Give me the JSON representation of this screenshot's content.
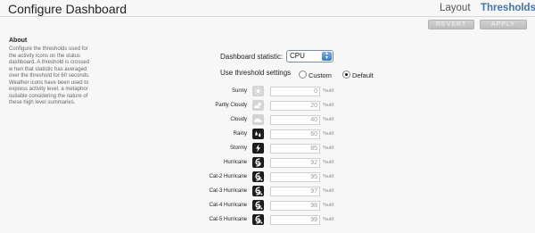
{
  "header": {
    "title": "Configure Dashboard",
    "tabs": {
      "layout": "Layout",
      "thresholds": "Thresholds"
    }
  },
  "toolbar": {
    "revert_label": "REVERT",
    "apply_label": "APPLY"
  },
  "about": {
    "title": "About",
    "lines": [
      "Configure the thresholds used for",
      "the activity icons on the status",
      "dashboard. A threshold is crossed",
      "w hen that statistic has averaged",
      "over the threshold for 60 seconds.",
      "Weather icons have been used to",
      "express activity level, a metaphor",
      "suitable considering the nature of",
      "these high level summaries."
    ]
  },
  "form": {
    "statistic_label": "Dashboard statistic:",
    "statistic_value": "CPU",
    "use_threshold_label": "Use threshold settings",
    "option_custom": "Custom",
    "option_default": "Default",
    "selected_option": "Default",
    "unit": "%util"
  },
  "thresholds": [
    {
      "label": "Sunny",
      "value": "0",
      "icon": "sun-icon"
    },
    {
      "label": "Partly Cloudy",
      "value": "20",
      "icon": "partly-cloudy-icon"
    },
    {
      "label": "Cloudy",
      "value": "40",
      "icon": "cloud-icon"
    },
    {
      "label": "Rainy",
      "value": "60",
      "icon": "rain-icon"
    },
    {
      "label": "Stormy",
      "value": "85",
      "icon": "lightning-icon"
    },
    {
      "label": "Hurricane",
      "value": "92",
      "icon": "hurricane-icon"
    },
    {
      "label": "Cat-2 Hurricane",
      "value": "95",
      "icon": "hurricane-cat2-icon"
    },
    {
      "label": "Cat-3 Hurricane",
      "value": "97",
      "icon": "hurricane-cat3-icon"
    },
    {
      "label": "Cat-4 Hurricane",
      "value": "98",
      "icon": "hurricane-cat4-icon"
    },
    {
      "label": "Cat-5 Hurricane",
      "value": "99",
      "icon": "hurricane-cat5-icon"
    }
  ],
  "colors": {
    "accent": "#3f74b5",
    "button": "#c8c8c8",
    "dark_icon": "#1c1c1c"
  }
}
